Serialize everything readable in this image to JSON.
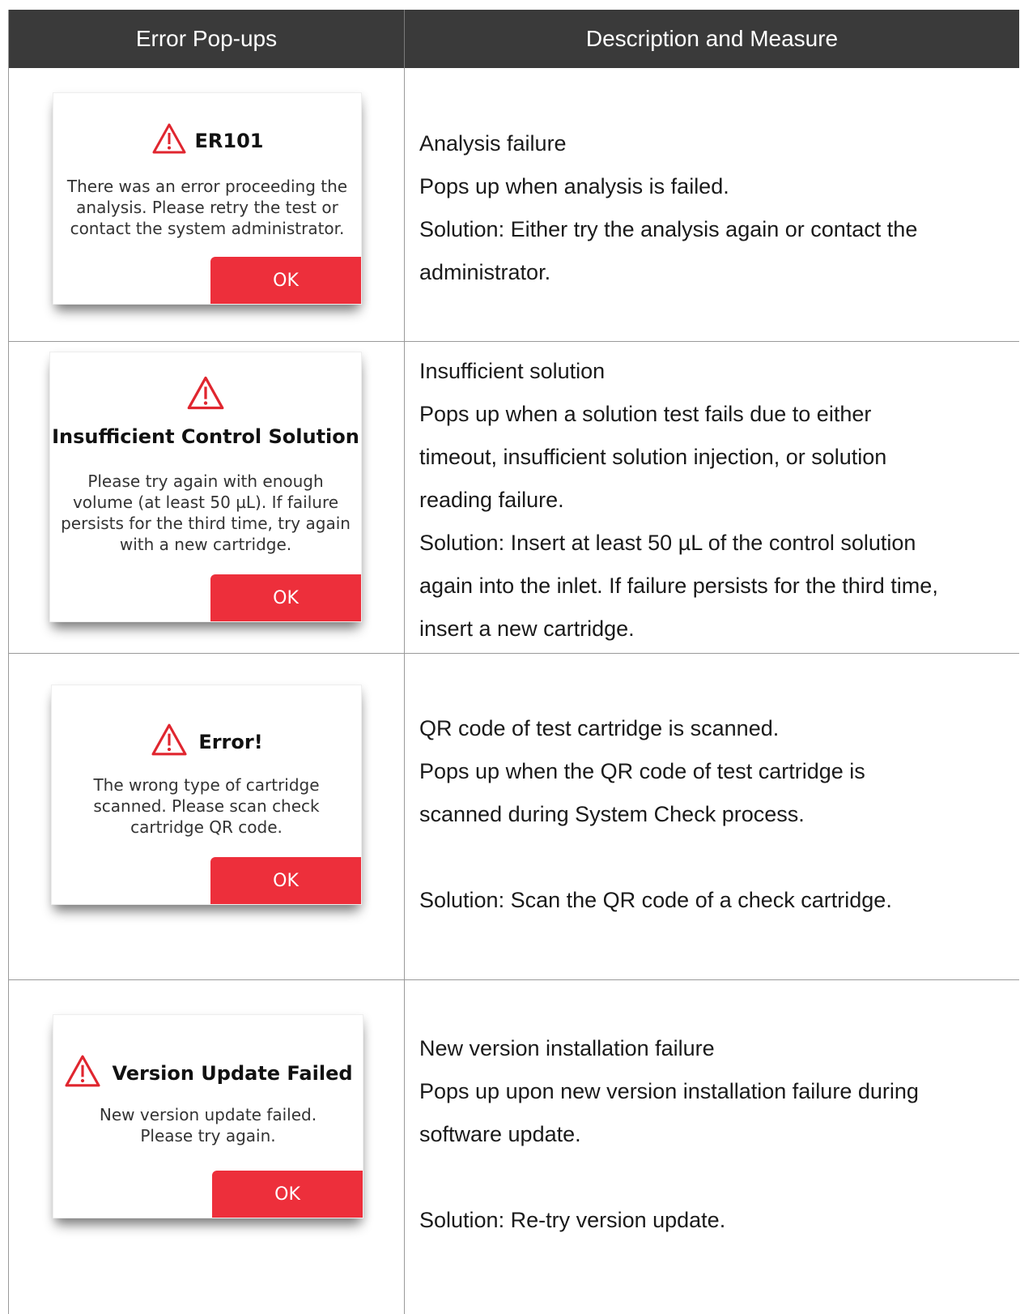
{
  "header": {
    "col1": "Error Pop-ups",
    "col2": "Description and Measure"
  },
  "rows": [
    {
      "popup": {
        "title": "ER101",
        "body": [
          "There was an error proceeding the",
          "analysis. Please retry the test or",
          "contact the system administrator."
        ],
        "ok": "OK"
      },
      "description": [
        "Analysis failure",
        "Pops up when analysis is failed.",
        "Solution: Either try the analysis again or contact the",
        "administrator."
      ]
    },
    {
      "popup": {
        "title": "Insufficient Control Solution",
        "body": [
          "Please try again with enough",
          "volume (at least 50 µL). If failure",
          "persists for the third time, try again",
          "with a new cartridge."
        ],
        "ok": "OK"
      },
      "description": [
        "Insufficient solution",
        "Pops up when a solution test fails due to either",
        "timeout, insufficient solution injection, or solution",
        "reading failure.",
        "Solution: Insert at least 50 µL of the control solution",
        "again into the inlet. If failure persists for the third time,",
        "insert a new cartridge."
      ]
    },
    {
      "popup": {
        "title": "Error!",
        "body": [
          "The wrong type of cartridge",
          "scanned. Please scan check",
          "cartridge QR code."
        ],
        "ok": "OK"
      },
      "description": [
        "QR code of test cartridge is scanned.",
        "Pops up when the QR code of test cartridge is",
        "scanned during System Check process.",
        "",
        "Solution: Scan the QR code of a check cartridge."
      ]
    },
    {
      "popup": {
        "title": "Version Update Failed",
        "body": [
          "New version update failed.",
          "Please try again."
        ],
        "ok": "OK"
      },
      "description": [
        "New version installation failure",
        "Pops up upon new version installation failure during",
        "software update.",
        "",
        "Solution: Re-try version update."
      ]
    }
  ],
  "colors": {
    "header_bg": "#3a3a3a",
    "ok_button": "#ed2f3b",
    "warning_icon": "#e0262f"
  }
}
